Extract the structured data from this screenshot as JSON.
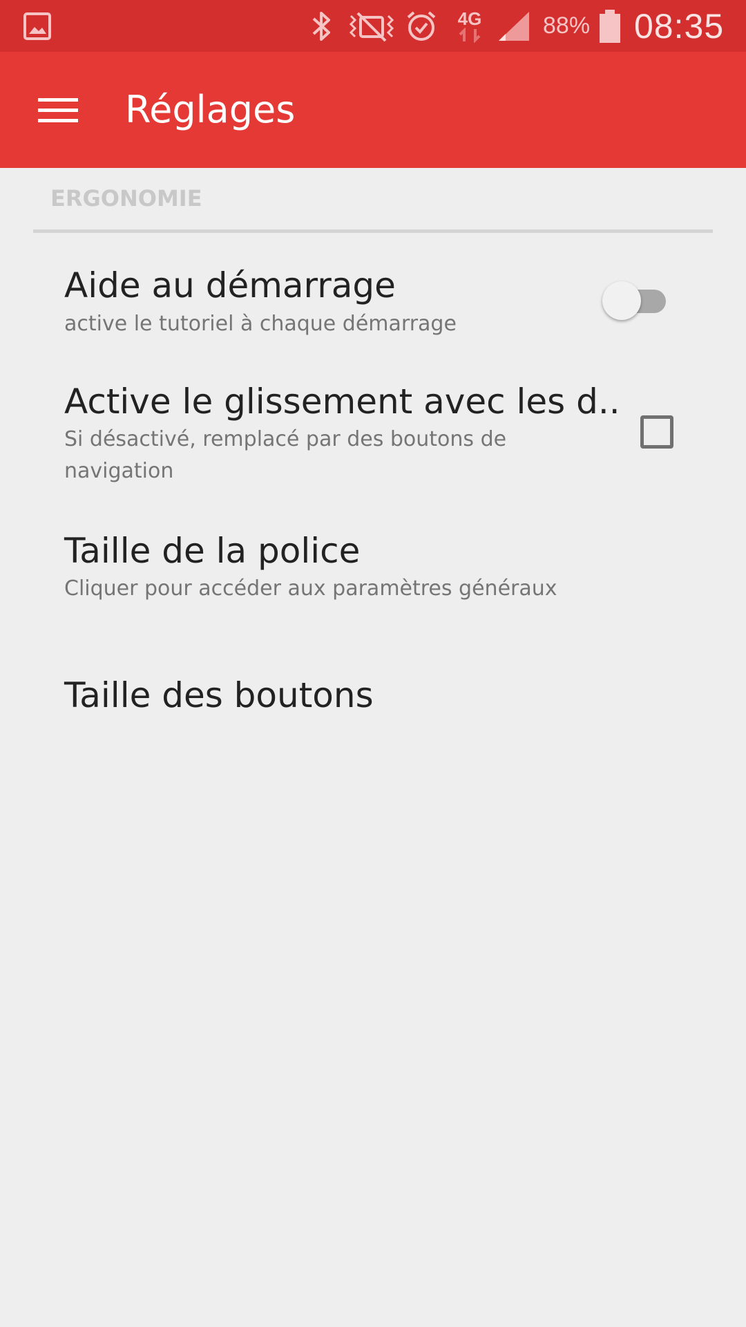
{
  "status_bar": {
    "icons": [
      "gallery-icon",
      "bluetooth-icon",
      "vibrate-off-icon",
      "alarm-icon",
      "network-4g-icon",
      "signal-icon",
      "battery-icon"
    ],
    "network_type": "4G",
    "battery_percent": "88%",
    "time": "08:35"
  },
  "app_bar": {
    "menu_icon": "hamburger-menu-icon",
    "title": "Réglages"
  },
  "colors": {
    "status_bar": "#d32f2f",
    "app_bar": "#e53935",
    "background": "#eeeeee"
  },
  "section": {
    "header": "ERGONOMIE"
  },
  "preferences": [
    {
      "title": "Aide au démarrage",
      "summary": "active le tutoriel à chaque démarrage",
      "control": "switch",
      "checked": false
    },
    {
      "title": "Active le glissement avec les d..",
      "summary": "Si désactivé, remplacé par des boutons de navigation",
      "control": "checkbox",
      "checked": false
    },
    {
      "title": "Taille de la police",
      "summary": "Cliquer pour accéder aux paramètres généraux"
    },
    {
      "title": "Taille des boutons"
    }
  ]
}
